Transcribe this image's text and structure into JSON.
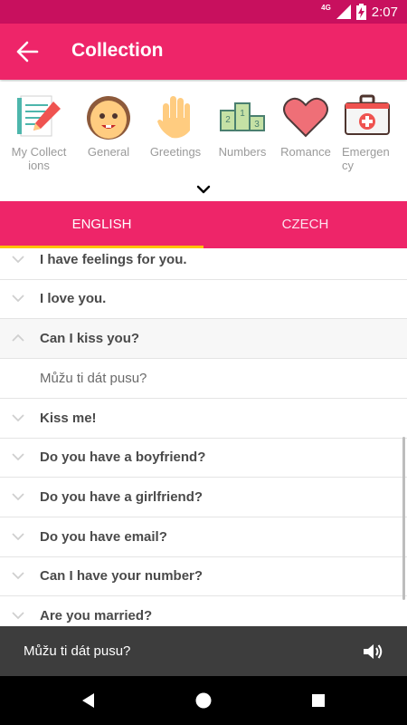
{
  "status": {
    "network": "4G",
    "time": "2:07"
  },
  "appbar": {
    "title": "Collection",
    "back_icon": "arrow-back-icon"
  },
  "categories": [
    {
      "label": "My Collections",
      "line1": "My Collect",
      "line2": "ions",
      "icon": "notebook-pencil-icon"
    },
    {
      "label": "General",
      "line1": "General",
      "line2": "",
      "icon": "smiling-face-icon"
    },
    {
      "label": "Greetings",
      "line1": "Greetings",
      "line2": "",
      "icon": "waving-hand-icon"
    },
    {
      "label": "Numbers",
      "line1": "Numbers",
      "line2": "",
      "icon": "podium-icon"
    },
    {
      "label": "Romance",
      "line1": "Romance",
      "line2": "",
      "icon": "heart-icon"
    },
    {
      "label": "Emergency",
      "line1": "Emergen",
      "line2": "cy",
      "icon": "first-aid-kit-icon"
    }
  ],
  "tabs": [
    {
      "label": "ENGLISH",
      "active": true
    },
    {
      "label": "CZECH",
      "active": false
    }
  ],
  "phrases": [
    {
      "text": "I have feelings for you.",
      "expanded": false
    },
    {
      "text": "I love you.",
      "expanded": false
    },
    {
      "text": "Can I kiss you?",
      "expanded": true,
      "translation": "Můžu ti dát pusu?"
    },
    {
      "text": "Kiss me!",
      "expanded": false
    },
    {
      "text": "Do you have a boyfriend?",
      "expanded": false
    },
    {
      "text": "Do you have a girlfriend?",
      "expanded": false
    },
    {
      "text": "Do you have email?",
      "expanded": false
    },
    {
      "text": "Can I have your number?",
      "expanded": false
    },
    {
      "text": "Are you married?",
      "expanded": false
    }
  ],
  "player": {
    "text": "Můžu ti dát pusu?",
    "icon": "speaker-icon"
  },
  "colors": {
    "primary": "#ee2569",
    "status_bar": "#c8105e",
    "tab_indicator": "#ffc107",
    "player_bg": "#3d3d3d"
  }
}
